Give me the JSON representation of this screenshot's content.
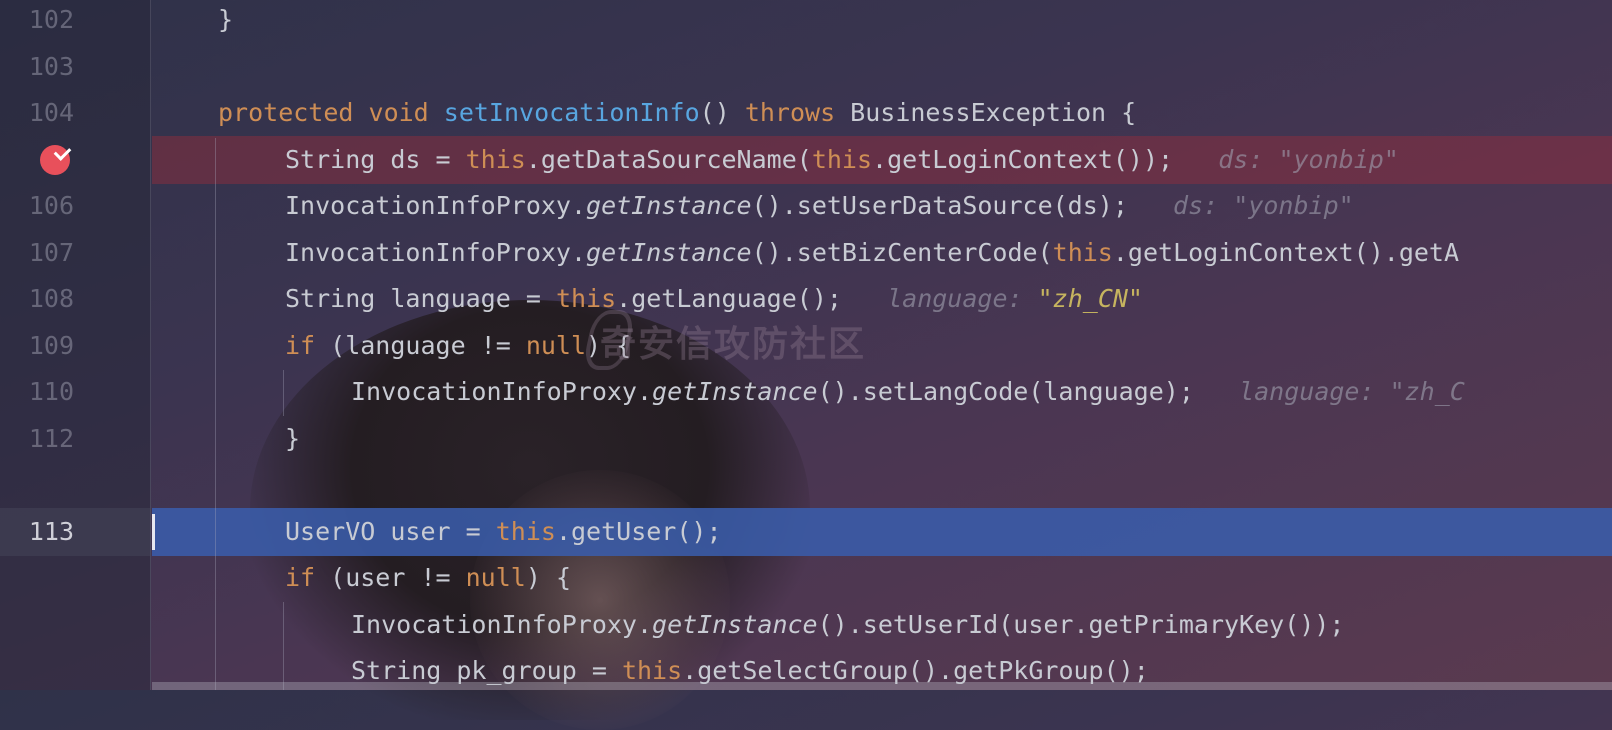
{
  "lines": [
    {
      "num": "102",
      "indent": 218,
      "tokens": [
        {
          "t": "}",
          "c": ""
        }
      ]
    },
    {
      "num": "103",
      "indent": 218,
      "tokens": []
    },
    {
      "num": "104",
      "indent": 218,
      "tokens": [
        {
          "t": "protected ",
          "c": "kw"
        },
        {
          "t": "void ",
          "c": "kw"
        },
        {
          "t": "setInvocationInfo",
          "c": "fn"
        },
        {
          "t": "() ",
          "c": ""
        },
        {
          "t": "throws ",
          "c": "kw"
        },
        {
          "t": "BusinessException {",
          "c": ""
        }
      ]
    },
    {
      "num": "",
      "indent": 285,
      "state": "breakpoint",
      "tokens": [
        {
          "t": "String ds = ",
          "c": ""
        },
        {
          "t": "this",
          "c": "kw"
        },
        {
          "t": ".getDataSourceName(",
          "c": ""
        },
        {
          "t": "this",
          "c": "kw"
        },
        {
          "t": ".getLoginContext());",
          "c": ""
        },
        {
          "t": "   ds: ",
          "c": "hint"
        },
        {
          "t": "\"yonbip\"",
          "c": "hint"
        }
      ]
    },
    {
      "num": "106",
      "indent": 285,
      "tokens": [
        {
          "t": "InvocationInfoProxy.",
          "c": ""
        },
        {
          "t": "getInstance",
          "c": "it"
        },
        {
          "t": "().setUserDataSource(ds);",
          "c": ""
        },
        {
          "t": "   ds: ",
          "c": "hint"
        },
        {
          "t": "\"yonbip\"",
          "c": "hint"
        }
      ]
    },
    {
      "num": "107",
      "indent": 285,
      "tokens": [
        {
          "t": "InvocationInfoProxy.",
          "c": ""
        },
        {
          "t": "getInstance",
          "c": "it"
        },
        {
          "t": "().setBizCenterCode(",
          "c": ""
        },
        {
          "t": "this",
          "c": "kw"
        },
        {
          "t": ".getLoginContext().getA",
          "c": ""
        }
      ]
    },
    {
      "num": "108",
      "indent": 285,
      "tokens": [
        {
          "t": "String language = ",
          "c": ""
        },
        {
          "t": "this",
          "c": "kw"
        },
        {
          "t": ".getLanguage();",
          "c": ""
        },
        {
          "t": "   language: ",
          "c": "hint"
        },
        {
          "t": "\"zh_CN\"",
          "c": "str"
        }
      ]
    },
    {
      "num": "109",
      "indent": 285,
      "tokens": [
        {
          "t": "if ",
          "c": "kw"
        },
        {
          "t": "(language != ",
          "c": ""
        },
        {
          "t": "null",
          "c": "kw"
        },
        {
          "t": ") {",
          "c": ""
        }
      ]
    },
    {
      "num": "110",
      "indent": 351,
      "tokens": [
        {
          "t": "InvocationInfoProxy.",
          "c": ""
        },
        {
          "t": "getInstance",
          "c": "it"
        },
        {
          "t": "().setLangCode(language);",
          "c": ""
        },
        {
          "t": "   language: ",
          "c": "hint"
        },
        {
          "t": "\"zh_C",
          "c": "hint"
        }
      ]
    },
    {
      "num": "112",
      "indent": 285,
      "tokens": [
        {
          "t": "}",
          "c": ""
        }
      ]
    },
    {
      "num": "",
      "indent": 285,
      "tokens": []
    },
    {
      "num": "113",
      "indent": 285,
      "state": "current",
      "tokens": [
        {
          "t": "UserVO user = ",
          "c": ""
        },
        {
          "t": "this",
          "c": "kw"
        },
        {
          "t": ".getUser();",
          "c": ""
        }
      ]
    },
    {
      "num": "",
      "indent": 285,
      "tokens": [
        {
          "t": "if ",
          "c": "kw"
        },
        {
          "t": "(user != ",
          "c": ""
        },
        {
          "t": "null",
          "c": "kw"
        },
        {
          "t": ") {",
          "c": ""
        }
      ]
    },
    {
      "num": "",
      "indent": 351,
      "tokens": [
        {
          "t": "InvocationInfoProxy.",
          "c": ""
        },
        {
          "t": "getInstance",
          "c": "it"
        },
        {
          "t": "().setUserId(user.getPrimaryKey());",
          "c": ""
        }
      ]
    },
    {
      "num": "",
      "indent": 351,
      "tokens": [
        {
          "t": "String pk_group = ",
          "c": ""
        },
        {
          "t": "this",
          "c": "kw"
        },
        {
          "t": ".getSelectGroup().getPkGroup();",
          "c": ""
        }
      ]
    }
  ],
  "watermark": "奇安信攻防社区",
  "colors": {
    "keyword": "#cf8e55",
    "method": "#58a6e0",
    "string": "#c6b45f",
    "breakpoint": "#e8505b",
    "current_line": "#3a5caa"
  }
}
